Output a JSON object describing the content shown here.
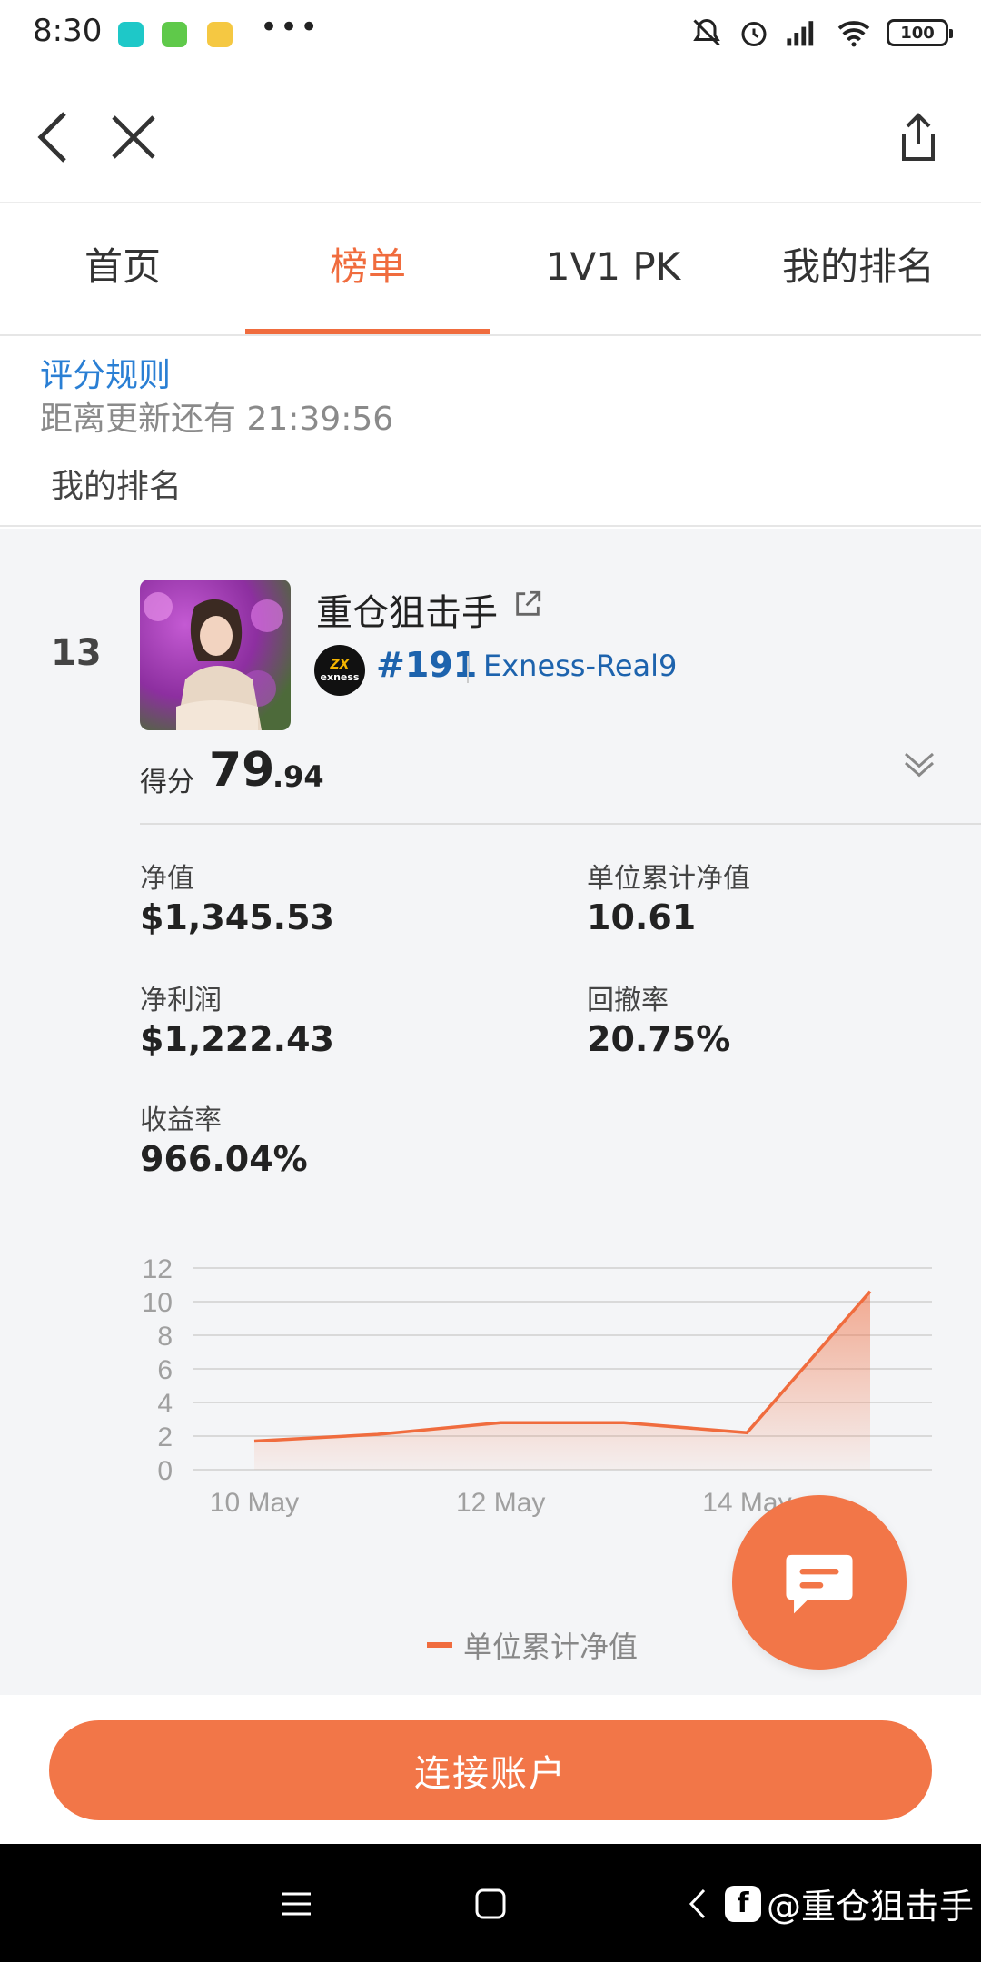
{
  "status_bar": {
    "time": "8:30",
    "more": "•••",
    "battery": "100",
    "icons": [
      "mute-icon",
      "alarm-icon",
      "signal-icon",
      "wifi-icon",
      "battery-icon"
    ]
  },
  "navbar": {
    "icons": [
      "back-icon",
      "close-icon",
      "share-icon"
    ]
  },
  "tabs": [
    {
      "label": "首页",
      "active": false
    },
    {
      "label": "榜单",
      "active": true
    },
    {
      "label": "1V1 PK",
      "active": false
    },
    {
      "label": "我的排名",
      "active": false
    }
  ],
  "rules": {
    "link": "评分规则",
    "countdown": "距离更新还有 21:39:56",
    "my_rank_label": "我的排名"
  },
  "card": {
    "rank": "13",
    "trader_name": "重仓狙击手",
    "broker_logo_text": "exness",
    "account_id": "#191",
    "server": "Exness-Real9",
    "score_label": "得分",
    "score_int": "79",
    "score_dec": ".94",
    "stats": {
      "nav_label": "净值",
      "nav_value": "$1,345.53",
      "unit_nav_label": "单位累计净值",
      "unit_nav_value": "10.61",
      "profit_label": "净利润",
      "profit_value": "$1,222.43",
      "drawdown_label": "回撤率",
      "drawdown_value": "20.75%",
      "return_label": "收益率",
      "return_value": "966.04%"
    }
  },
  "chart_data": {
    "type": "area",
    "x": [
      "10 May",
      "11 May",
      "12 May",
      "13 May",
      "14 May",
      "15 May"
    ],
    "x_tick_labels": [
      "10 May",
      "12 May",
      "14 May"
    ],
    "series": [
      {
        "name": "单位累计净值",
        "values": [
          1.7,
          2.1,
          2.8,
          2.8,
          2.2,
          10.61
        ]
      }
    ],
    "ylim": [
      0,
      12
    ],
    "y_ticks": [
      "0",
      "2",
      "4",
      "6",
      "8",
      "10",
      "12"
    ],
    "grid": true,
    "legend_position": "bottom",
    "color": "#f06c3e"
  },
  "actions": {
    "connect": "连接账户"
  },
  "watermark": "@重仓狙击手",
  "colors": {
    "accent": "#f06c3e",
    "link": "#2a7fd4",
    "account": "#1d63ad"
  }
}
